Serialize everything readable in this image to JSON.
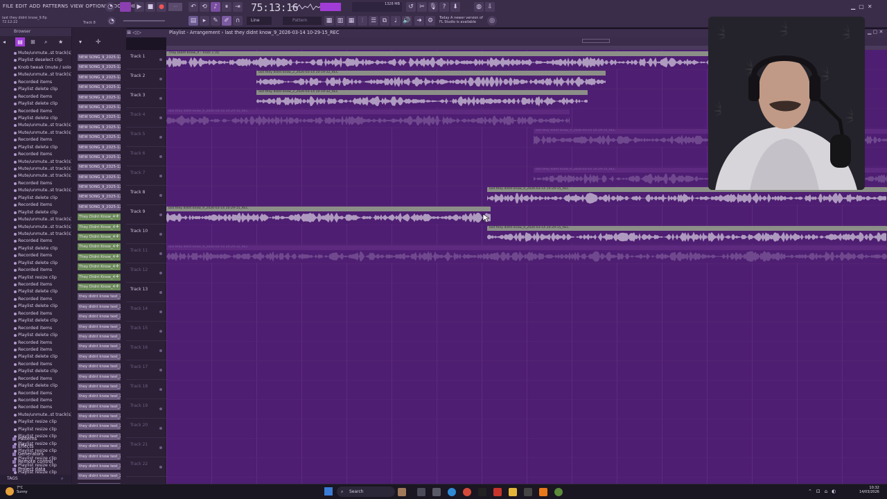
{
  "menu": [
    "FILE",
    "EDIT",
    "ADD",
    "PATTERNS",
    "VIEW",
    "OPTIONS",
    "TOOLS",
    "HELP"
  ],
  "project_hint": {
    "line1": "last they didnt know_9.flp",
    "line2": "72:12:22",
    "track": "Track 8"
  },
  "transport": {
    "time": "75:13:16",
    "pattern_label": "Pattern",
    "snap_label": "Line",
    "cpu_mem": "1328 MB"
  },
  "news": {
    "line1": "Today  A newer version of",
    "line2": "FL Studio is available"
  },
  "browser": {
    "title": "Browser",
    "history": [
      "Mute/unmute..st track(s)",
      "Playlist deselect clip",
      "Knob tweak (mute / solo)",
      "Mute/unmute..st track(s)",
      "Recorded items",
      "Playlist delete clip",
      "Recorded items",
      "Playlist delete clip",
      "Recorded items",
      "Playlist delete clip",
      "Mute/unmute..st track(s)",
      "Mute/unmute..st track(s)",
      "Recorded items",
      "Playlist delete clip",
      "Recorded items",
      "Mute/unmute..st track(s)",
      "Mute/unmute..st track(s)",
      "Mute/unmute..st track(s)",
      "Recorded items",
      "Mute/unmute..st track(s)",
      "Playlist delete clip",
      "Recorded items",
      "Playlist delete clip",
      "Mute/unmute..st track(s)",
      "Mute/unmute..st track(s)",
      "Mute/unmute..st track(s)",
      "Recorded items",
      "Playlist delete clip",
      "Recorded items",
      "Playlist delete clip",
      "Recorded items",
      "Playlist resize clip",
      "Recorded items",
      "Playlist delete clip",
      "Recorded items",
      "Playlist delete clip",
      "Recorded items",
      "Playlist delete clip",
      "Recorded items",
      "Playlist delete clip",
      "Recorded items",
      "Recorded items",
      "Playlist delete clip",
      "Recorded items",
      "Playlist delete clip",
      "Recorded items",
      "Playlist delete clip",
      "Recorded items",
      "Recorded items",
      "Recorded items",
      "Mute/unmute..st track(s)",
      "Playlist resize clip",
      "Playlist resize clip",
      "Playlist resize clip",
      "Playlist resize clip",
      "Playlist resize clip",
      "Playlist resize clip",
      "Playlist resize clip",
      "Playlist resize clip"
    ],
    "sections": [
      "Patterns",
      "Effects",
      "Generators",
      "Remote control",
      "Project data"
    ],
    "tags_label": "TAGS"
  },
  "channels": [
    {
      "label": "NEW SONG_9_2025-12-2",
      "color": "purple"
    },
    {
      "label": "NEW SONG_9_2025-12-2",
      "color": "purple"
    },
    {
      "label": "NEW SONG_9_2025-12-2",
      "color": "purple"
    },
    {
      "label": "NEW SONG_9_2025-12-2",
      "color": "purple"
    },
    {
      "label": "NEW SONG_9_2025-12-2",
      "color": "purple"
    },
    {
      "label": "NEW SONG_9_2025-12-2",
      "color": "purple"
    },
    {
      "label": "NEW SONG_9_2025-12-2",
      "color": "purple"
    },
    {
      "label": "NEW SONG_9_2025-12-2",
      "color": "purple"
    },
    {
      "label": "NEW SONG_9_2025-12-2",
      "color": "purple"
    },
    {
      "label": "NEW SONG_9_2025-12-2",
      "color": "purple"
    },
    {
      "label": "NEW SONG_9_2025-12-2",
      "color": "purple"
    },
    {
      "label": "NEW SONG_9_2025-12-2",
      "color": "purple"
    },
    {
      "label": "NEW SONG_9_2025-12-2",
      "color": "purple"
    },
    {
      "label": "NEW SONG_9_2025-12-2",
      "color": "purple"
    },
    {
      "label": "NEW SONG_9_2025-12-2",
      "color": "purple"
    },
    {
      "label": "NEW SONG_9_2025-12-2",
      "color": "purple"
    },
    {
      "label": "They Didnt Know_4 -",
      "color": "green"
    },
    {
      "label": "They Didnt Know_4 -",
      "color": "green"
    },
    {
      "label": "They Didnt Know_4 -",
      "color": "green"
    },
    {
      "label": "They Didnt Know_4 -",
      "color": "green"
    },
    {
      "label": "They Didnt Know_4 -",
      "color": "green"
    },
    {
      "label": "They Didnt Know_4 -",
      "color": "green"
    },
    {
      "label": "They Didnt Know_4 -",
      "color": "green"
    },
    {
      "label": "They Didnt Know_4 -",
      "color": "green"
    },
    {
      "label": "they didnt know test_20",
      "color": "purple"
    },
    {
      "label": "they didnt know test_20",
      "color": "purple"
    },
    {
      "label": "they didnt know test_20",
      "color": "purple"
    },
    {
      "label": "they didnt know test_20",
      "color": "purple"
    },
    {
      "label": "they didnt know test_20",
      "color": "purple"
    },
    {
      "label": "they didnt know test_20",
      "color": "purple"
    },
    {
      "label": "they didnt know test_20",
      "color": "purple"
    },
    {
      "label": "they didnt know test_20",
      "color": "purple"
    },
    {
      "label": "they didnt know test_20",
      "color": "purple"
    },
    {
      "label": "they didnt know test_20",
      "color": "purple"
    },
    {
      "label": "they didnt know test_20",
      "color": "purple"
    },
    {
      "label": "they didnt know test_20",
      "color": "purple"
    },
    {
      "label": "they didnt know test_20",
      "color": "purple"
    },
    {
      "label": "they didnt know test_20",
      "color": "purple"
    },
    {
      "label": "they didnt know test_20",
      "color": "purple"
    },
    {
      "label": "they didnt know test_20",
      "color": "purple"
    },
    {
      "label": "they didnt know test_20",
      "color": "purple"
    },
    {
      "label": "they didnt know test_20",
      "color": "purple"
    },
    {
      "label": "they didnt know test_20",
      "color": "purple"
    },
    {
      "label": "they didnt know test_20",
      "color": "purple"
    },
    {
      "label": "they didnt know test_20",
      "color": "purple"
    }
  ],
  "playlist": {
    "title": "Playlist - Arrangement › last they didnt know_9_2026-03-14 10-29-15_REC",
    "tracks": [
      {
        "name": "Track 1",
        "active": true
      },
      {
        "name": "Track 2",
        "active": true
      },
      {
        "name": "Track 3",
        "active": true
      },
      {
        "name": "Track 4",
        "active": false
      },
      {
        "name": "Track 5",
        "active": false
      },
      {
        "name": "Track 6",
        "active": false
      },
      {
        "name": "Track 7",
        "active": false
      },
      {
        "name": "Track 8",
        "active": true
      },
      {
        "name": "Track 9",
        "active": true
      },
      {
        "name": "Track 10",
        "active": true
      },
      {
        "name": "Track 11",
        "active": false
      },
      {
        "name": "Track 12",
        "active": false
      },
      {
        "name": "Track 13",
        "active": true
      },
      {
        "name": "Track 14",
        "active": false
      },
      {
        "name": "Track 15",
        "active": false
      },
      {
        "name": "Track 16",
        "active": false
      },
      {
        "name": "Track 17",
        "active": false
      },
      {
        "name": "Track 18",
        "active": false
      },
      {
        "name": "Track 19",
        "active": false
      },
      {
        "name": "Track 20",
        "active": false
      },
      {
        "name": "Track 21",
        "active": false
      },
      {
        "name": "Track 22",
        "active": false
      }
    ],
    "clips": [
      {
        "track": 1,
        "label": "They Didnt Know_4 - Track 1 [4]",
        "start": 0.0,
        "end": 0.8,
        "muted": false
      },
      {
        "track": 2,
        "label": "last they didnt know_2_2026-03-14 10-19-32_REC",
        "start": 0.125,
        "end": 0.61,
        "muted": false
      },
      {
        "track": 3,
        "label": "last they didnt know_2_2026-03-14 10-19-32_REC",
        "start": 0.125,
        "end": 0.585,
        "muted": false
      },
      {
        "track": 4,
        "label": "last they didnt know_9_2026-03-14 10-29-15_REC",
        "start": 0.0,
        "end": 0.56,
        "muted": true
      },
      {
        "track": 5,
        "label": "last they didnt know_9_2026-03-14 10-29-15_REC",
        "start": 0.51,
        "end": 1.0,
        "muted": true
      },
      {
        "track": 7,
        "label": "last they didnt know_9_2026-03-14 10-29-15_REC",
        "start": 0.51,
        "end": 1.0,
        "muted": true
      },
      {
        "track": 8,
        "label": "last they didnt know_9_2026-03-14 10-29-15_REC",
        "start": 0.445,
        "end": 1.0,
        "muted": false
      },
      {
        "track": 9,
        "label": "last they didnt know_9_2026-03-14 10-29-15_REC",
        "start": 0.0,
        "end": 0.45,
        "muted": false
      },
      {
        "track": 10,
        "label": "last they didnt know_9_2026-03-14 10-29-15_REC",
        "start": 0.445,
        "end": 1.0,
        "muted": false
      },
      {
        "track": 11,
        "label": "last they didnt know_9_2026-03-14 10-29-15_REC",
        "start": 0.0,
        "end": 1.0,
        "muted": true
      }
    ]
  },
  "taskbar": {
    "weather_temp": "7°C",
    "weather_desc": "Sunny",
    "search_label": "Search",
    "clock_time": "10:32",
    "clock_date": "14/03/2026"
  },
  "colors": {
    "playlist_bg": "#4e1e72",
    "clip_header": "#8c8f88",
    "wave": "#b9a9c8",
    "accent_green": "#6b8a58"
  }
}
